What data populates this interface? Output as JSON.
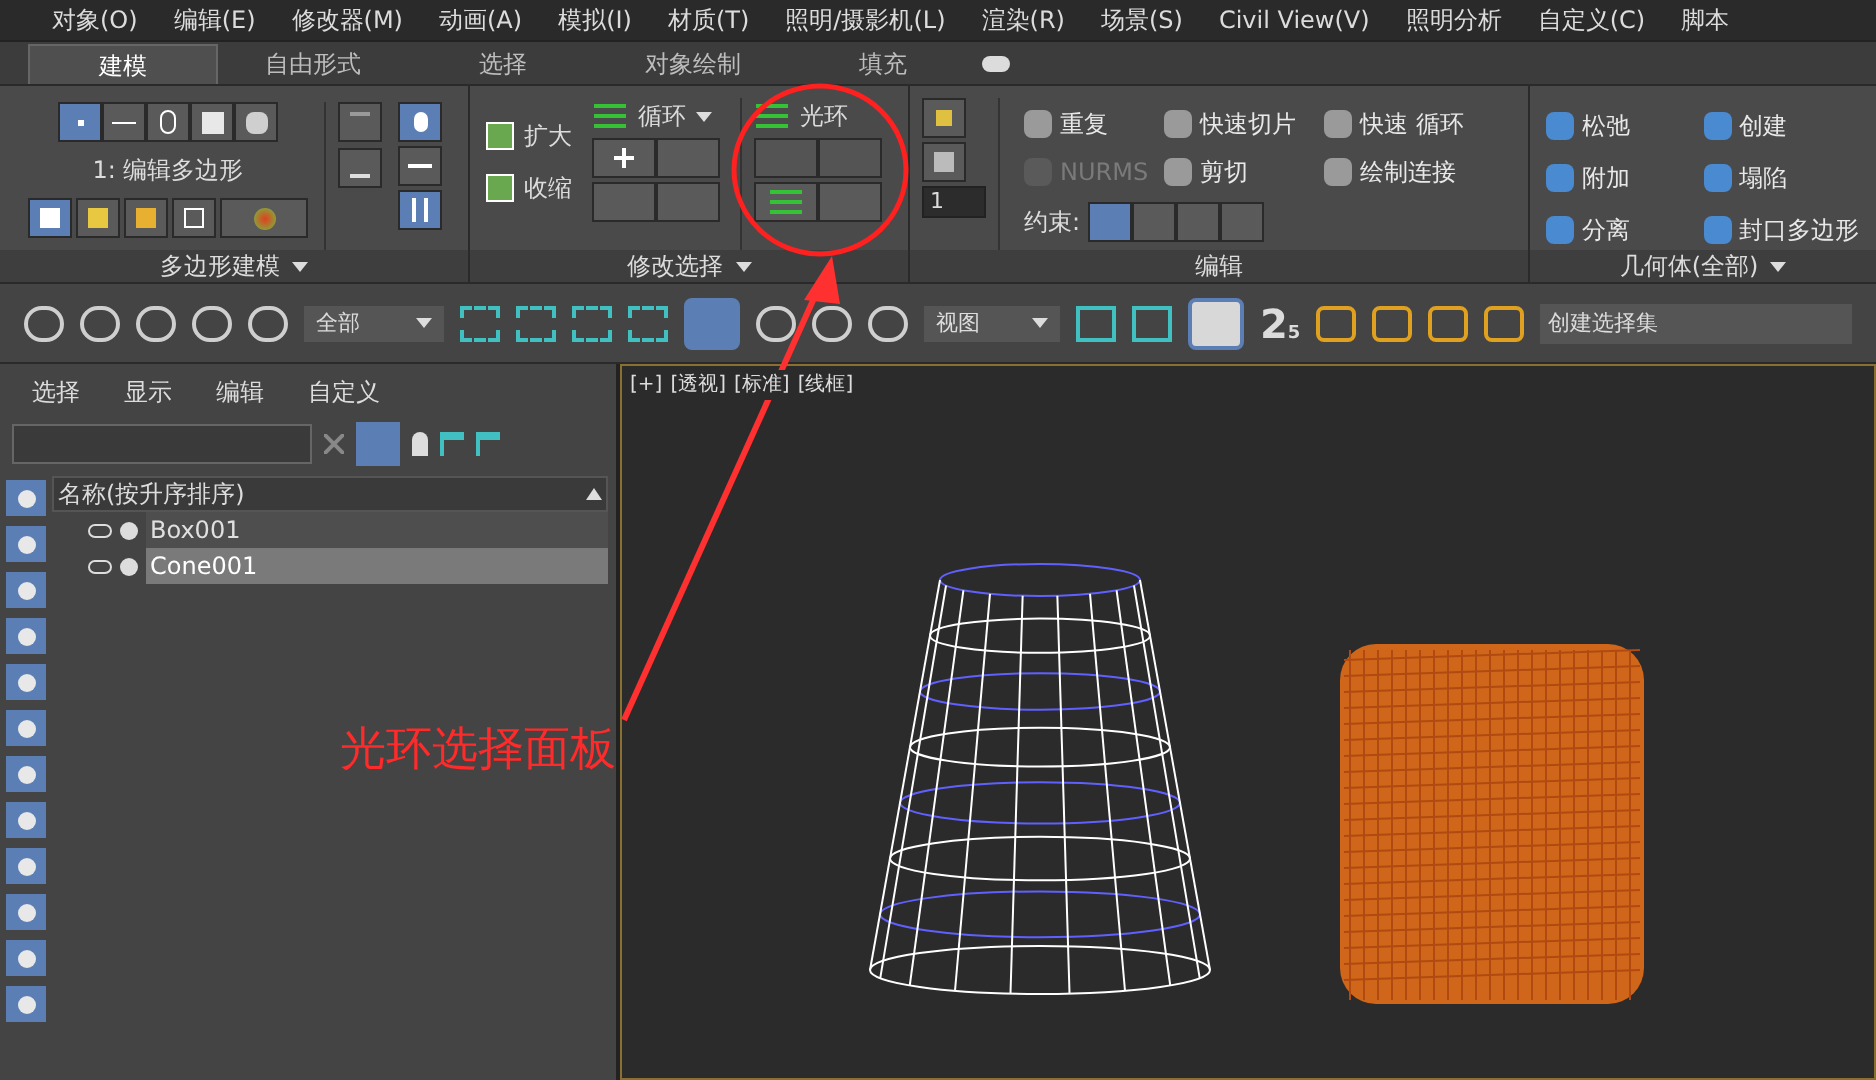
{
  "menu": [
    "对象(O)",
    "编辑(E)",
    "修改器(M)",
    "动画(A)",
    "模拟(I)",
    "材质(T)",
    "照明/摄影机(L)",
    "渲染(R)",
    "场景(S)",
    "Civil View(V)",
    "照明分析",
    "自定义(C)",
    "脚本"
  ],
  "ribbon_tabs": [
    {
      "label": "建模",
      "selected": true
    },
    {
      "label": "自由形式",
      "selected": false
    },
    {
      "label": "选择",
      "selected": false
    },
    {
      "label": "对象绘制",
      "selected": false
    },
    {
      "label": "填充",
      "selected": false
    }
  ],
  "polygon_modeling": {
    "modifier": "1: 编辑多边形",
    "title": "多边形建模"
  },
  "modify_selection": {
    "grow": "扩大",
    "shrink": "收缩",
    "loop": "循环",
    "ring": "光环",
    "title": "修改选择"
  },
  "edit": {
    "spinner": "1",
    "items": [
      {
        "label": "重复",
        "disabled": false
      },
      {
        "label": "快速切片",
        "disabled": false
      },
      {
        "label": "快速 循环",
        "disabled": false
      },
      {
        "label": "NURMS",
        "disabled": true
      },
      {
        "label": "剪切",
        "disabled": false
      },
      {
        "label": "绘制连接",
        "disabled": false
      }
    ],
    "constraints": "约束:",
    "title": "编辑"
  },
  "geometry": {
    "items": [
      "松弛",
      "创建",
      "附加",
      "塌陷",
      "分离",
      "封口多边形"
    ],
    "title": "几何体(全部)"
  },
  "toolbar": {
    "selection_filter": "全部",
    "coordinate": "视图",
    "snap_label": "2",
    "snap_sub": "5",
    "selection_set": "创建选择集"
  },
  "scene_explorer": {
    "menu": [
      "选择",
      "显示",
      "编辑",
      "自定义"
    ],
    "column": "名称(按升序排序)",
    "rows": [
      {
        "name": "Box001",
        "selected": false
      },
      {
        "name": "Cone001",
        "selected": true
      }
    ]
  },
  "viewport": {
    "labels": [
      "[+]",
      "[透视]",
      "[标准]",
      "[线框]"
    ]
  },
  "annotation": {
    "text": "光环选择面板"
  }
}
